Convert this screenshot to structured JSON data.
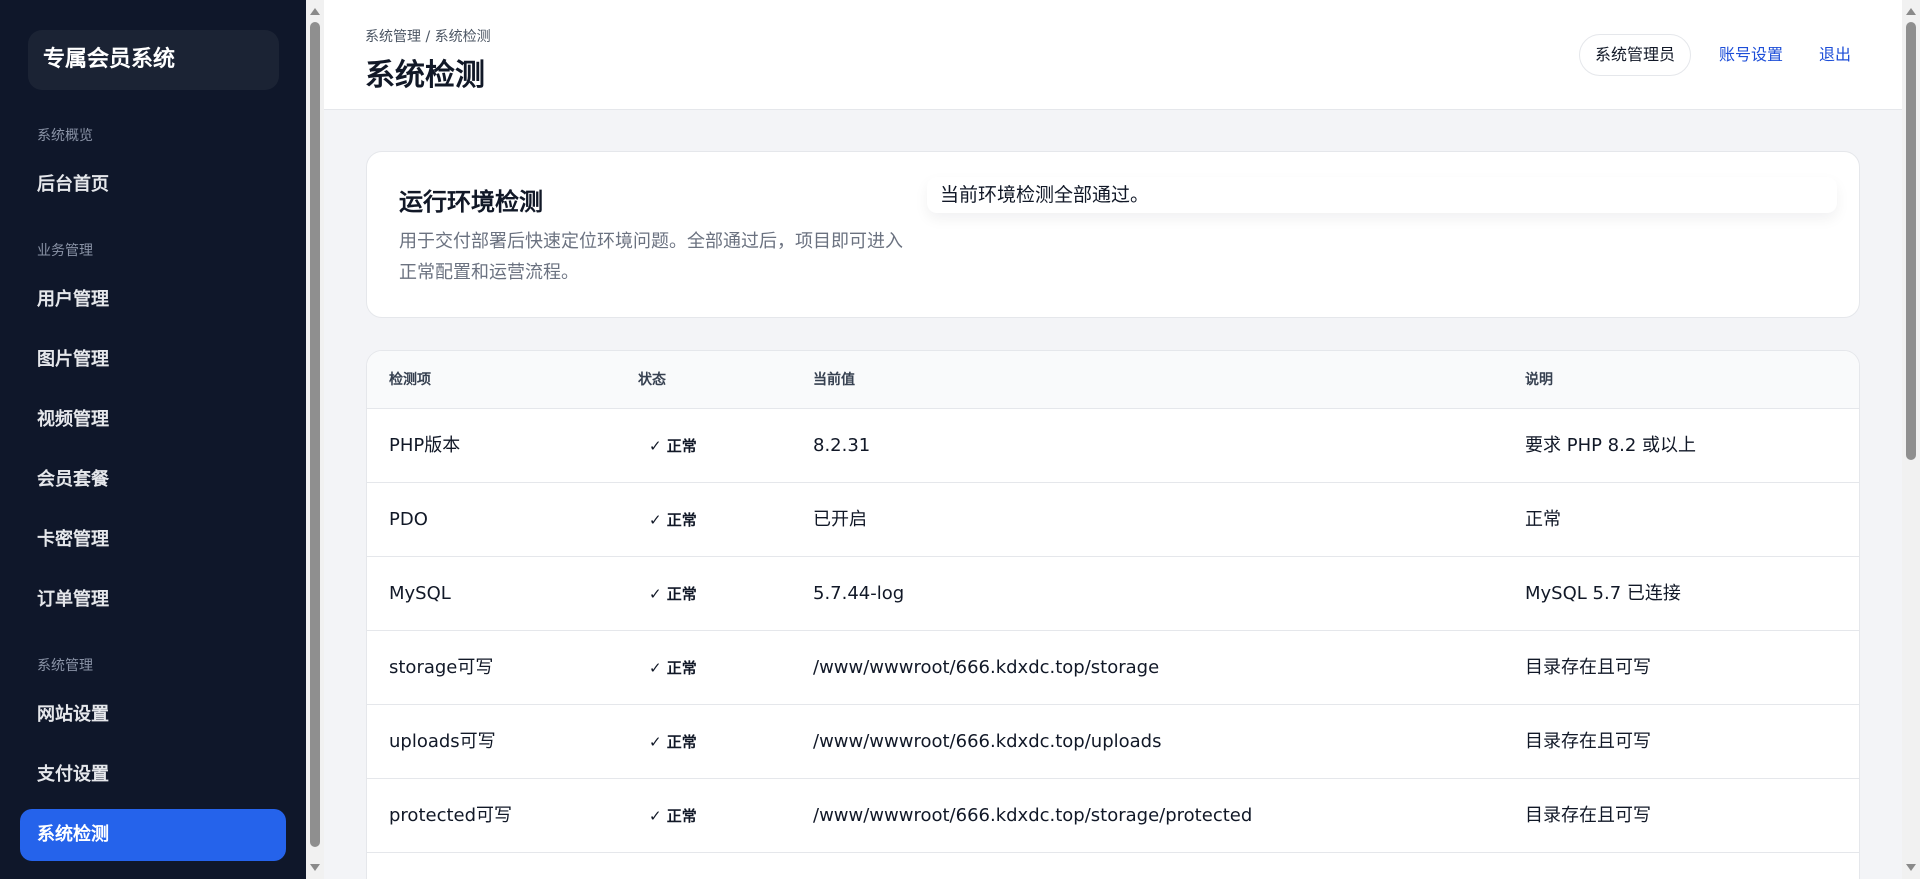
{
  "sidebar": {
    "brand": "专属会员系统",
    "sections": [
      {
        "title": "系统概览",
        "items": [
          "后台首页"
        ]
      },
      {
        "title": "业务管理",
        "items": [
          "用户管理",
          "图片管理",
          "视频管理",
          "会员套餐",
          "卡密管理",
          "订单管理"
        ]
      },
      {
        "title": "系统管理",
        "items": [
          "网站设置",
          "支付设置",
          "系统检测"
        ]
      }
    ],
    "active_item": "系统检测"
  },
  "header": {
    "breadcrumb": "系统管理 / 系统检测",
    "title": "系统检测",
    "admin_label": "系统管理员",
    "account_settings": "账号设置",
    "logout": "退出"
  },
  "check_card": {
    "title": "运行环境检测",
    "description": "用于交付部署后快速定位环境问题。全部通过后，项目即可进入正常配置和运营流程。",
    "notice": "当前环境检测全部通过。"
  },
  "table": {
    "columns": [
      "检测项",
      "状态",
      "当前值",
      "说明"
    ],
    "status_icon": "check-icon",
    "rows": [
      {
        "item": "PHP版本",
        "status": "✓ 正常",
        "value": "8.2.31",
        "note": "要求 PHP 8.2 或以上"
      },
      {
        "item": "PDO",
        "status": "✓ 正常",
        "value": "已开启",
        "note": "正常"
      },
      {
        "item": "MySQL",
        "status": "✓ 正常",
        "value": "5.7.44-log",
        "note": "MySQL 5.7 已连接"
      },
      {
        "item": "storage可写",
        "status": "✓ 正常",
        "value": "/www/wwwroot/666.kdxdc.top/storage",
        "note": "目录存在且可写"
      },
      {
        "item": "uploads可写",
        "status": "✓ 正常",
        "value": "/www/wwwroot/666.kdxdc.top/uploads",
        "note": "目录存在且可写"
      },
      {
        "item": "protected可写",
        "status": "✓ 正常",
        "value": "/www/wwwroot/666.kdxdc.top/storage/protected",
        "note": "目录存在且可写"
      }
    ]
  },
  "colors": {
    "sidebar_bg": "#0f172a",
    "active_bg": "#2563eb",
    "link": "#1d4ed8",
    "page_bg": "#f3f4f7"
  }
}
